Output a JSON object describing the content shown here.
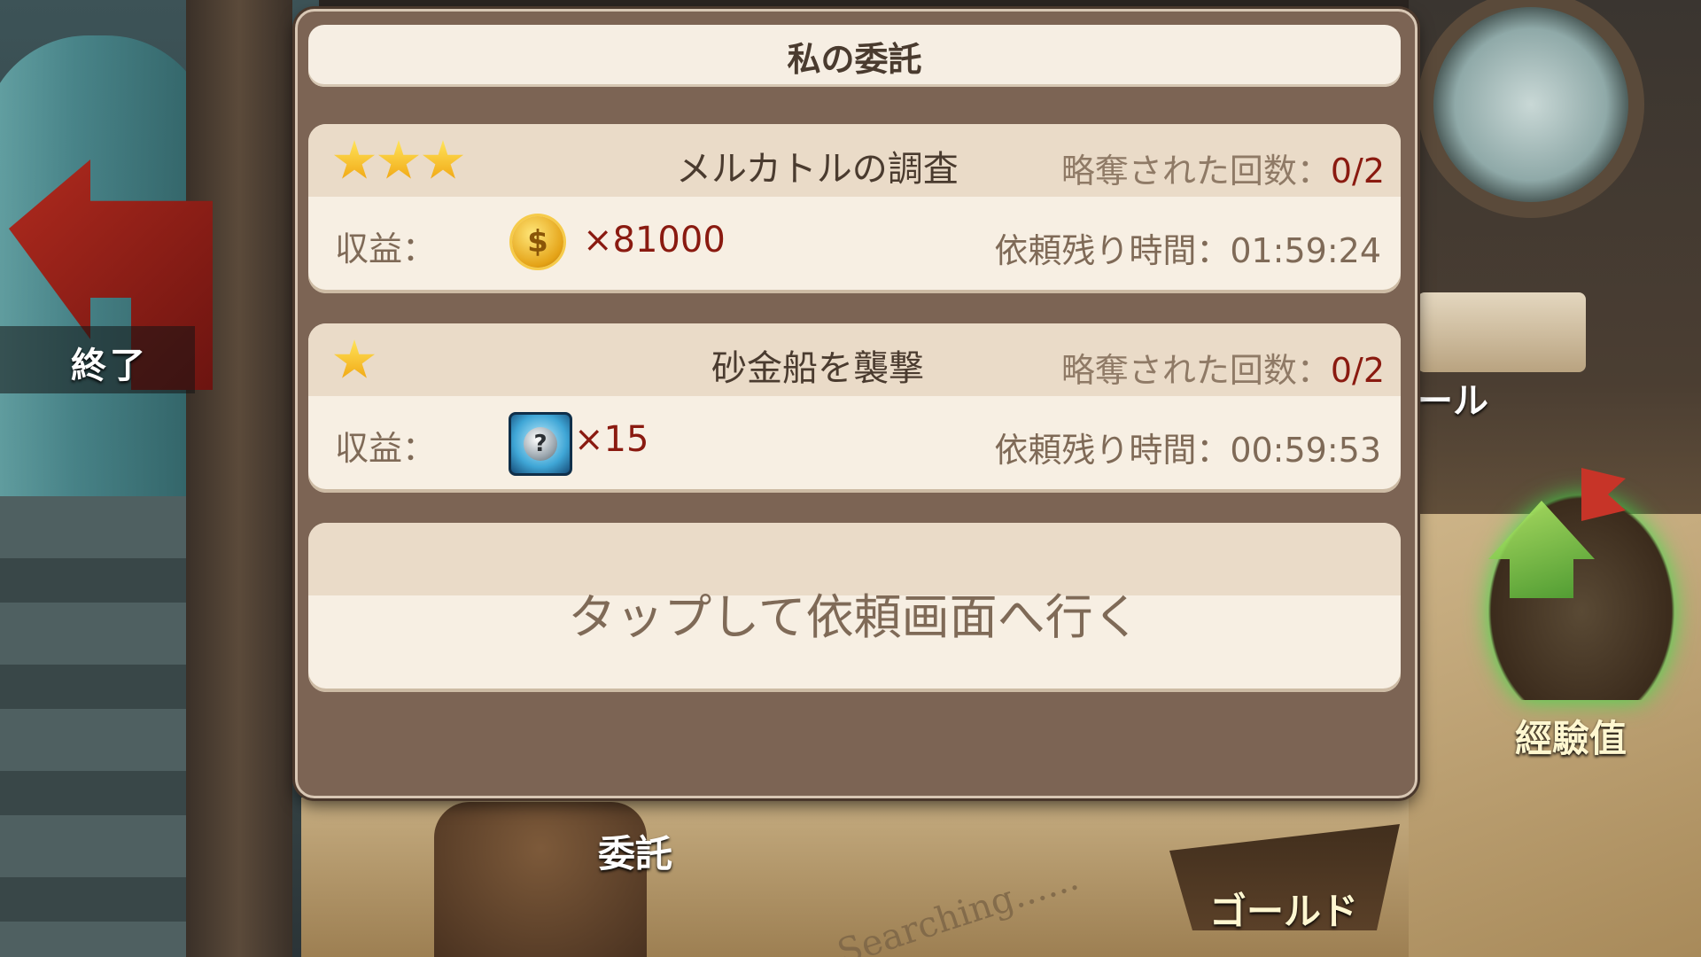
{
  "background": {
    "exit_label": "終了",
    "scroll_label": "ール",
    "exp_label": "經驗值",
    "commission_label": "委託",
    "gold_label": "ゴールド",
    "searching_text": "Searching......"
  },
  "panel": {
    "title": "私の委託",
    "raid_count_label": "略奪された回数：",
    "reward_label": "収益：",
    "time_label": "依頼残り時間：",
    "missions": [
      {
        "name": "メルカトルの調査",
        "stars": 3,
        "raid_count": "0/2",
        "reward_icon": "gold-coin-icon",
        "reward_qty": "×81000",
        "time_remaining": "01:59:24"
      },
      {
        "name": "砂金船を襲撃",
        "stars": 1,
        "raid_count": "0/2",
        "reward_icon": "mystery-gem-icon",
        "reward_qty": "×15",
        "time_remaining": "00:59:53"
      }
    ],
    "tap_prompt": "タップして依頼画面へ行く"
  },
  "colors": {
    "panel_bg": "#7c6454",
    "card_bg": "#f7efe3",
    "card_head": "#eadbc8",
    "accent_red": "#8a1a10",
    "text_main": "#4a3b2f",
    "text_muted": "#7f6a57"
  }
}
